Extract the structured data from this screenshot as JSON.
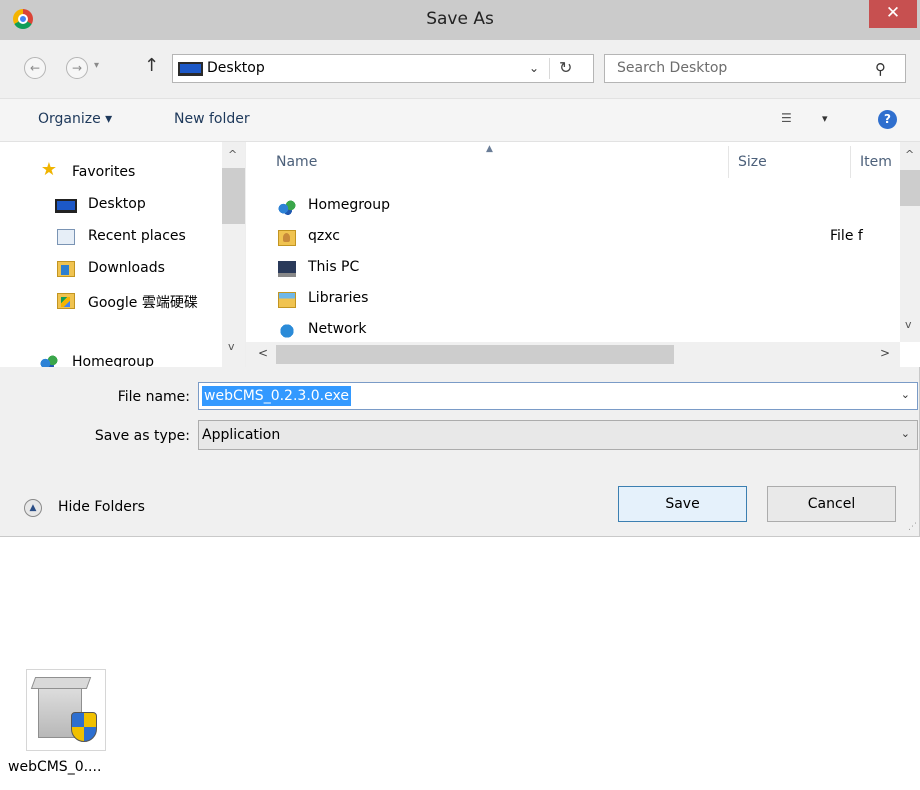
{
  "window": {
    "title": "Save As",
    "close_glyph": "✕"
  },
  "navigation": {
    "back_glyph": "←",
    "forward_glyph": "→",
    "recent_glyph": "▾",
    "up_glyph": "↑",
    "address": "Desktop",
    "address_dropdown_glyph": "⌄",
    "refresh_glyph": "↻",
    "search_placeholder": "Search Desktop",
    "search_glyph": "⚲"
  },
  "toolbar": {
    "organize": "Organize ▾",
    "new_folder": "New folder",
    "view_glyph": "☰",
    "view_dropdown_glyph": "▾",
    "help_glyph": "?"
  },
  "nav_pane": {
    "items": [
      {
        "label": "Favorites",
        "icon": "star-icon"
      },
      {
        "label": "Desktop",
        "icon": "desktop-icon"
      },
      {
        "label": "Recent places",
        "icon": "recent-places-icon"
      },
      {
        "label": "Downloads",
        "icon": "downloads-folder-icon"
      },
      {
        "label": "Google 雲端硬碟",
        "icon": "google-drive-folder-icon"
      },
      {
        "label": "Homegroup",
        "icon": "homegroup-icon"
      }
    ],
    "scroll_up_glyph": "^",
    "scroll_down_glyph": "v"
  },
  "file_list": {
    "columns": {
      "name": "Name",
      "size": "Size",
      "type": "Item"
    },
    "sort_glyph": "▲",
    "rows": [
      {
        "name": "Homegroup",
        "type": "",
        "icon": "homegroup-icon"
      },
      {
        "name": "qzxc",
        "type": "File f",
        "icon": "user-folder-icon"
      },
      {
        "name": "This PC",
        "type": "",
        "icon": "this-pc-icon"
      },
      {
        "name": "Libraries",
        "type": "",
        "icon": "libraries-icon"
      },
      {
        "name": "Network",
        "type": "",
        "icon": "network-icon"
      }
    ],
    "scroll_left_glyph": "<",
    "scroll_right_glyph": ">",
    "scroll_up_glyph": "^",
    "scroll_down_glyph": "v"
  },
  "form": {
    "file_name_label": "File name:",
    "file_name_value": "webCMS_0.2.3.0.exe",
    "save_type_label": "Save as type:",
    "save_type_value": "Application",
    "dropdown_glyph": "⌄"
  },
  "footer": {
    "hide_folders": "Hide Folders",
    "hide_folders_glyph": "▲",
    "save": "Save",
    "cancel": "Cancel",
    "grip_glyph": "⋰"
  },
  "desktop": {
    "file_label": "webCMS_0....",
    "file_icon": "installer-icon"
  }
}
